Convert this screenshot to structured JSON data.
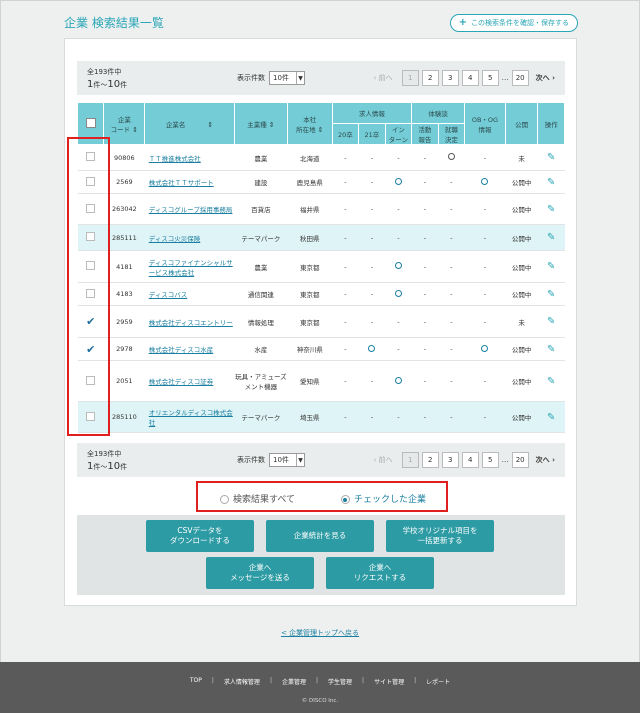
{
  "page": {
    "title": "企業 検索結果一覧",
    "save_conditions": "この検索条件を確認・保存する"
  },
  "pager": {
    "total_label": "全193件中",
    "range_from": "1",
    "range_sep": "件～",
    "range_to": "10",
    "range_unit": "件",
    "per_page_label": "表示件数",
    "per_page_value": "10件",
    "prev": "前へ",
    "next": "次へ",
    "pages": [
      "1",
      "2",
      "3",
      "4",
      "5"
    ],
    "ellipsis": "…",
    "last_page": "20"
  },
  "table": {
    "headers": {
      "code": "企業\nコード",
      "name": "企業名",
      "category": "主業種",
      "location": "本社\n所在地",
      "recruit_group": "求人情報",
      "recruit_20": "20卒",
      "recruit_21": "21卒",
      "recruit_intern": "イン\nターン",
      "exp_group": "体験談",
      "exp_activity": "活動\n報告",
      "exp_decision": "就職\n決定",
      "obog": "OB・OG\n情報",
      "status": "公開",
      "ops": "操作"
    },
    "rows": [
      {
        "checked": false,
        "code": "90806",
        "name": "ＴＴ推進株式会社",
        "category": "農業",
        "location": "北海道",
        "r20": "-",
        "r21": "-",
        "intern": "-",
        "activity": "-",
        "decision": "◯",
        "obog": "-",
        "status": "未"
      },
      {
        "checked": false,
        "code": "2569",
        "name": "株式会社ＴＴサポート",
        "category": "建設",
        "location": "鹿児島県",
        "r20": "-",
        "r21": "-",
        "intern": "◯",
        "activity": "-",
        "decision": "-",
        "obog": "◯",
        "status": "公開中"
      },
      {
        "checked": false,
        "code": "263042",
        "name": "ディスコグループ採用事務局",
        "category": "百貨店",
        "location": "福井県",
        "r20": "-",
        "r21": "-",
        "intern": "-",
        "activity": "-",
        "decision": "-",
        "obog": "-",
        "status": "公開中"
      },
      {
        "checked": false,
        "code": "285111",
        "name": "ディスコ火災保険",
        "category": "テーマパーク",
        "location": "秋田県",
        "r20": "-",
        "r21": "-",
        "intern": "-",
        "activity": "-",
        "decision": "-",
        "obog": "-",
        "status": "公開中"
      },
      {
        "checked": false,
        "code": "4181",
        "name": "ディスコファイナンシャルサービス株式会社",
        "category": "農業",
        "location": "東京都",
        "r20": "-",
        "r21": "-",
        "intern": "◯",
        "activity": "-",
        "decision": "-",
        "obog": "-",
        "status": "公開中"
      },
      {
        "checked": false,
        "code": "4183",
        "name": "ディスコバス",
        "category": "通信関連",
        "location": "東京都",
        "r20": "-",
        "r21": "-",
        "intern": "◯",
        "activity": "-",
        "decision": "-",
        "obog": "-",
        "status": "公開中"
      },
      {
        "checked": true,
        "code": "2959",
        "name": "株式会社ディスコエントリー",
        "category": "情報処理",
        "location": "東京都",
        "r20": "-",
        "r21": "-",
        "intern": "-",
        "activity": "-",
        "decision": "-",
        "obog": "-",
        "status": "未"
      },
      {
        "checked": true,
        "code": "2978",
        "name": "株式会社ディスコ水産",
        "category": "水産",
        "location": "神奈川県",
        "r20": "-",
        "r21": "◯",
        "intern": "-",
        "activity": "-",
        "decision": "-",
        "obog": "◯",
        "status": "公開中"
      },
      {
        "checked": false,
        "code": "2051",
        "name": "株式会社ディスコ証券",
        "category": "玩具・アミューズメント機器",
        "location": "愛知県",
        "r20": "-",
        "r21": "-",
        "intern": "◯",
        "activity": "-",
        "decision": "-",
        "obog": "-",
        "status": "公開中"
      },
      {
        "checked": false,
        "code": "285110",
        "name": "オリエンタルディスコ株式会社",
        "category": "テーマパーク",
        "location": "埼玉県",
        "r20": "-",
        "r21": "-",
        "intern": "-",
        "activity": "-",
        "decision": "-",
        "obog": "-",
        "status": "公開中"
      }
    ]
  },
  "target": {
    "all_results": "検索結果すべて",
    "checked_only": "チェックした企業",
    "selected": "checked_only"
  },
  "actions": {
    "csv": "CSVデータを\nダウンロードする",
    "stats": "企業統計を見る",
    "bulk_update": "学校オリジナル項目を\n一括更新する",
    "message": "企業へ\nメッセージを送る",
    "request": "企業へ\nリクエストする"
  },
  "back_link": "< 企業管理トップへ戻る",
  "footer": {
    "nav": [
      "TOP",
      "求人情報管理",
      "企業管理",
      "学生管理",
      "サイト管理",
      "レポート"
    ],
    "copyright": "© DISCO Inc."
  },
  "colors": {
    "accent": "#2aa6b6",
    "header": "#74cdd6",
    "button": "#2d9ba4",
    "highlight": "#e0201e"
  }
}
